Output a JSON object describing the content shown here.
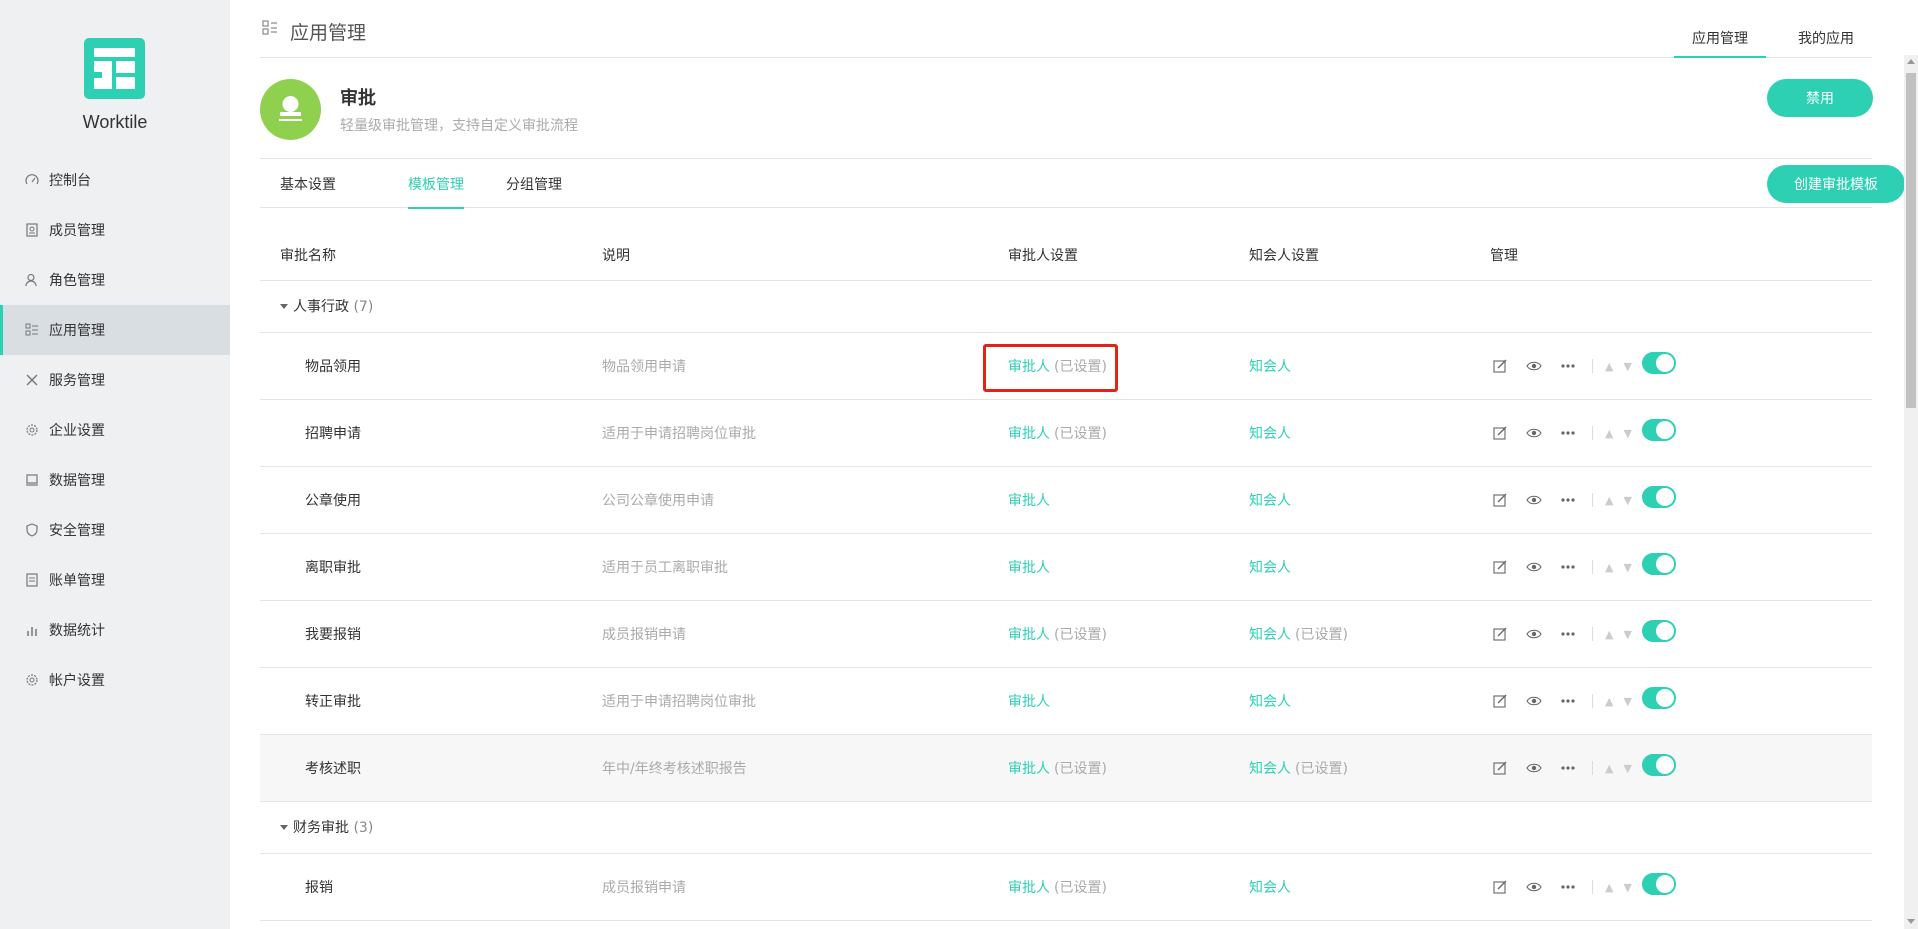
{
  "sidebar": {
    "brand": "Worktile",
    "items": [
      {
        "label": "控制台",
        "icon": "gauge-icon",
        "active": false
      },
      {
        "label": "成员管理",
        "icon": "member-icon",
        "active": false
      },
      {
        "label": "角色管理",
        "icon": "role-icon",
        "active": false
      },
      {
        "label": "应用管理",
        "icon": "app-list-icon",
        "active": true
      },
      {
        "label": "服务管理",
        "icon": "tools-icon",
        "active": false
      },
      {
        "label": "企业设置",
        "icon": "gear-icon",
        "active": false
      },
      {
        "label": "数据管理",
        "icon": "data-icon",
        "active": false
      },
      {
        "label": "安全管理",
        "icon": "shield-icon",
        "active": false
      },
      {
        "label": "账单管理",
        "icon": "bill-icon",
        "active": false
      },
      {
        "label": "数据统计",
        "icon": "stats-icon",
        "active": false
      },
      {
        "label": "帐户设置",
        "icon": "account-gear-icon",
        "active": false
      }
    ]
  },
  "header": {
    "title": "应用管理",
    "tabs": [
      {
        "label": "应用管理",
        "active": true
      },
      {
        "label": "我的应用",
        "active": false
      }
    ]
  },
  "app": {
    "name": "审批",
    "description": "轻量级审批管理，支持自定义审批流程",
    "disable_label": "禁用"
  },
  "subtabs": [
    {
      "label": "基本设置",
      "active": false
    },
    {
      "label": "模板管理",
      "active": true
    },
    {
      "label": "分组管理",
      "active": false
    }
  ],
  "create_label": "创建审批模板",
  "table": {
    "columns": [
      "审批名称",
      "说明",
      "审批人设置",
      "知会人设置",
      "管理"
    ],
    "groups": [
      {
        "name": "人事行政",
        "count": "(7)",
        "rows": [
          {
            "name": "物品领用",
            "desc": "物品领用申请",
            "approver": "审批人",
            "approver_set": "(已设置)",
            "cc": "知会人",
            "cc_set": ""
          },
          {
            "name": "招聘申请",
            "desc": "适用于申请招聘岗位审批",
            "approver": "审批人",
            "approver_set": "(已设置)",
            "cc": "知会人",
            "cc_set": ""
          },
          {
            "name": "公章使用",
            "desc": "公司公章使用申请",
            "approver": "审批人",
            "approver_set": "",
            "cc": "知会人",
            "cc_set": ""
          },
          {
            "name": "离职审批",
            "desc": "适用于员工离职审批",
            "approver": "审批人",
            "approver_set": "",
            "cc": "知会人",
            "cc_set": ""
          },
          {
            "name": "我要报销",
            "desc": "成员报销申请",
            "approver": "审批人",
            "approver_set": "(已设置)",
            "cc": "知会人",
            "cc_set": "(已设置)"
          },
          {
            "name": "转正审批",
            "desc": "适用于申请招聘岗位审批",
            "approver": "审批人",
            "approver_set": "",
            "cc": "知会人",
            "cc_set": ""
          },
          {
            "name": "考核述职",
            "desc": "年中/年终考核述职报告",
            "approver": "审批人",
            "approver_set": "(已设置)",
            "cc": "知会人",
            "cc_set": "(已设置)"
          }
        ]
      },
      {
        "name": "财务审批",
        "count": "(3)",
        "rows": [
          {
            "name": "报销",
            "desc": "成员报销申请",
            "approver": "审批人",
            "approver_set": "(已设置)",
            "cc": "知会人",
            "cc_set": ""
          }
        ]
      }
    ]
  },
  "colors": {
    "accent": "#2ed0b4",
    "highlight": "#e8201a",
    "app_avatar": "#8fd04f"
  }
}
